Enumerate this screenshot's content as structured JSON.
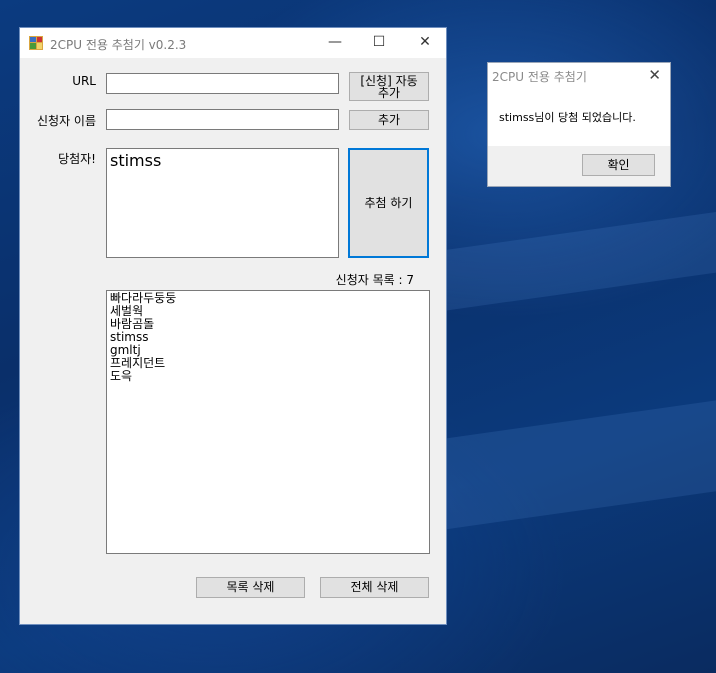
{
  "main_window": {
    "title": "2CPU 전용 추첨기 v0.2.3",
    "controls": {
      "minimize": "—",
      "maximize": "☐",
      "close": "✕"
    },
    "url_label": "URL",
    "url_value": "",
    "auto_add_button": [
      "[신청] 자동",
      "추가"
    ],
    "applicant_name_label": "신청자 이름",
    "applicant_name_value": "",
    "add_button": "추가",
    "winner_label": "당첨자!",
    "winner_value": "stimss",
    "draw_button": "추첨 하기",
    "applicant_count_label": "신청자 목록 : 7",
    "applicants": [
      "빠다라두둥둥",
      "세벌웍",
      "바람곰돌",
      "stimss",
      "gmltj",
      "프레지던트",
      "도윽"
    ],
    "delete_selected_button": "목록 삭제",
    "delete_all_button": "전체 삭제"
  },
  "dialog": {
    "title": "2CPU 전용 추첨기",
    "close": "✕",
    "message": "stimss님이 당첨 되었습니다.",
    "ok_button": "확인"
  },
  "colors": {
    "accent": "#0078d7",
    "button": "#e1e1e1",
    "window_bg": "#f0f0f0"
  }
}
